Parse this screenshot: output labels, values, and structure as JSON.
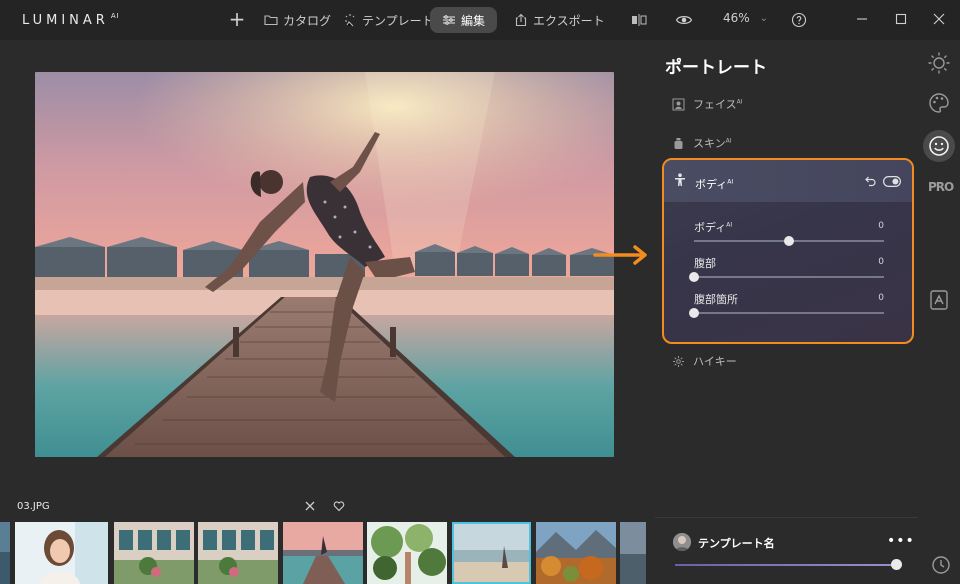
{
  "app": {
    "logo": "LUMINAR",
    "logo_sup": "AI"
  },
  "topbar": {
    "add_label": "+",
    "tabs": [
      {
        "label": "カタログ",
        "icon": "folder-icon"
      },
      {
        "label": "テンプレート",
        "icon": "sparkle-icon"
      },
      {
        "label": "編集",
        "icon": "sliders-icon",
        "active": true
      },
      {
        "label": "エクスポート",
        "icon": "share-icon"
      }
    ],
    "zoom": "46%",
    "zoom_chevron": "⌄"
  },
  "panel": {
    "title": "ポートレート",
    "tools": [
      {
        "label": "フェイス",
        "sup": "AI",
        "icon": "face-frame-icon"
      },
      {
        "label": "スキン",
        "sup": "AI",
        "icon": "bottle-icon"
      },
      {
        "label": "ハイキー",
        "sup": "",
        "icon": "highkey-icon"
      }
    ],
    "body_card": {
      "title": "ボディ",
      "title_sup": "AI",
      "sliders": [
        {
          "label": "ボディ",
          "sup": "AI",
          "value": "0",
          "position": 0.5
        },
        {
          "label": "腹部",
          "sup": "",
          "value": "0",
          "position": 0.0
        },
        {
          "label": "腹部箇所",
          "sup": "",
          "value": "0",
          "position": 0.0
        }
      ]
    }
  },
  "sidebar": {
    "pro_label": "PRO"
  },
  "filmstrip": {
    "filename": "03.JPG"
  },
  "template": {
    "name": "テンプレート名",
    "more": "•••",
    "amount": 1.0
  },
  "colors": {
    "accent_orange": "#f28c1e",
    "selected_thumb": "#4fc2df"
  }
}
